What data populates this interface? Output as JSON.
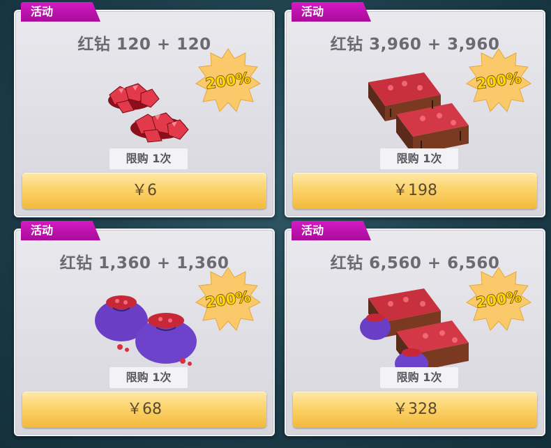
{
  "colors": {
    "tag": "#b812a8",
    "button": "#fcd36b",
    "badge": "#f9c96a"
  },
  "offers": [
    {
      "tag": "活动",
      "title": "红钻 120 + 120",
      "bonus": "200%",
      "limit": "限购 1次",
      "price": "￥6",
      "art": "ruby-pile"
    },
    {
      "tag": "活动",
      "title": "红钻 3,960 + 3,960",
      "bonus": "200%",
      "limit": "限购 1次",
      "price": "￥198",
      "art": "ruby-crates"
    },
    {
      "tag": "活动",
      "title": "红钻 1,360 + 1,360",
      "bonus": "200%",
      "limit": "限购 1次",
      "price": "￥68",
      "art": "ruby-bags"
    },
    {
      "tag": "活动",
      "title": "红钻 6,560 + 6,560",
      "bonus": "200%",
      "limit": "限购 1次",
      "price": "￥328",
      "art": "ruby-crates-bags"
    }
  ]
}
